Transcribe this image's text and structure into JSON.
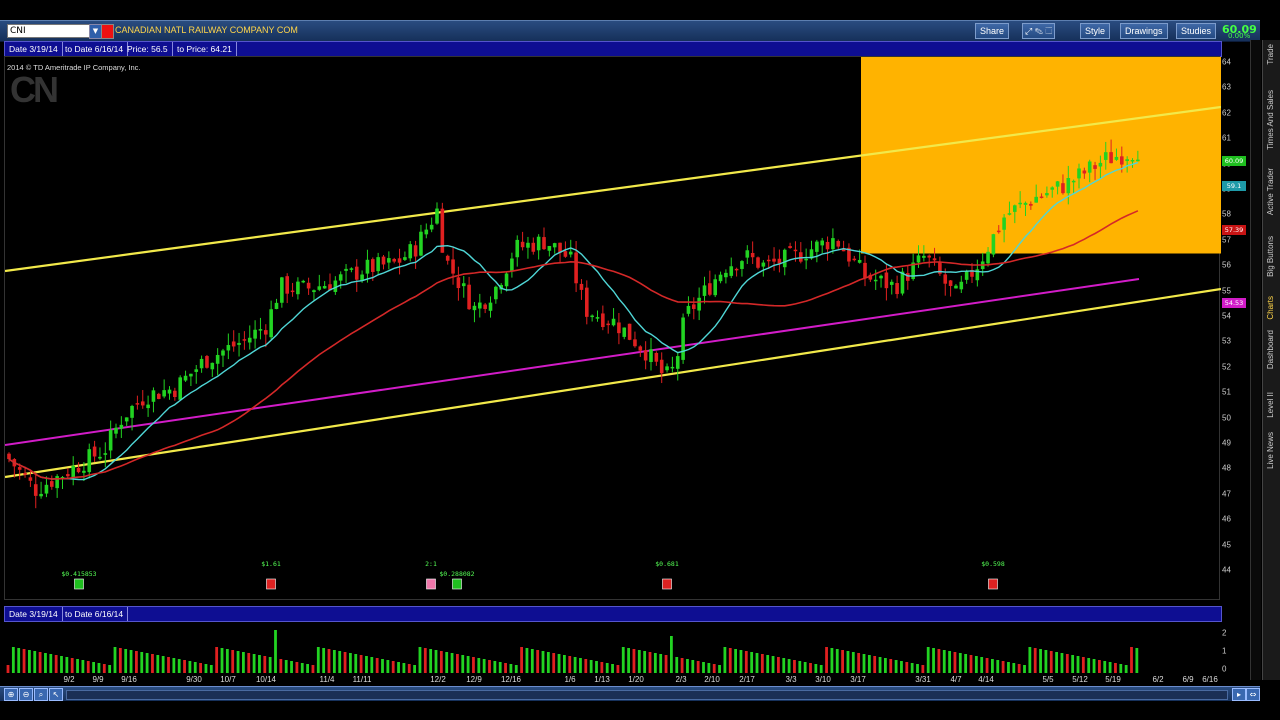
{
  "header": {
    "symbol": "CNI",
    "company": "CANADIAN NATL RAILWAY COMPANY COM",
    "buttons": [
      "Share",
      "Style",
      "Drawings",
      "Studies"
    ],
    "price": "60.09",
    "change": "0.00%"
  },
  "infobar": {
    "date_from": "Date 3/19/14",
    "date_to": "to Date 6/16/14",
    "price_from": "Price:  56.5",
    "price_to": "to Price:  64.21"
  },
  "volume_infobar": {
    "date_from": "Date 3/19/14",
    "date_to": "to Date 6/16/14"
  },
  "chart": {
    "copyright": "2014 © TD Ameritrade IP Company, Inc.",
    "logo_text": "CN",
    "y_labels": [
      "64",
      "63",
      "62",
      "61",
      "60",
      "59",
      "58",
      "57",
      "56",
      "55",
      "54",
      "53",
      "52",
      "51",
      "50",
      "49",
      "48",
      "47",
      "46",
      "45",
      "44"
    ],
    "price_badges": [
      {
        "text": "60.09",
        "value": 60.09,
        "color": "#1fbf1f"
      },
      {
        "text": "59.1",
        "value": 59.1,
        "color": "#1e9aa8"
      },
      {
        "text": "57.39",
        "value": 57.39,
        "color": "#c81414"
      },
      {
        "text": "54.53",
        "value": 54.53,
        "color": "#d21cc8"
      }
    ],
    "dividends": [
      {
        "label": "$0.415853",
        "date_index": 0,
        "color": "#1fbf1f"
      },
      {
        "label": "$1.61",
        "date_index": 1,
        "color": "#d22"
      },
      {
        "label": "2:1",
        "date_index": 2,
        "color": "#e7a"
      },
      {
        "label": "$0.288082",
        "date_index": 3,
        "color": "#1fbf1f"
      },
      {
        "label": "$0.681",
        "date_index": 4,
        "color": "#d22"
      },
      {
        "label": "$0.598",
        "date_index": 5,
        "color": "#d22"
      }
    ],
    "x_labels": [
      "9/2",
      "9/9",
      "9/16",
      "9/30",
      "10/7",
      "10/14",
      "11/4",
      "11/11",
      "12/2",
      "12/9",
      "12/16",
      "1/6",
      "1/13",
      "1/20",
      "2/3",
      "2/10",
      "2/17",
      "3/3",
      "3/10",
      "3/17",
      "3/31",
      "4/7",
      "4/14",
      "5/5",
      "5/12",
      "5/19",
      "6/2",
      "6/9",
      "6/16"
    ],
    "volume_labels": [
      "2",
      "1",
      "0"
    ]
  },
  "side_tabs": [
    "Trade",
    "Times And Sales",
    "Active Trader",
    "Big Buttons",
    "Charts",
    "Dashboard",
    "Level II",
    "Live News"
  ]
}
